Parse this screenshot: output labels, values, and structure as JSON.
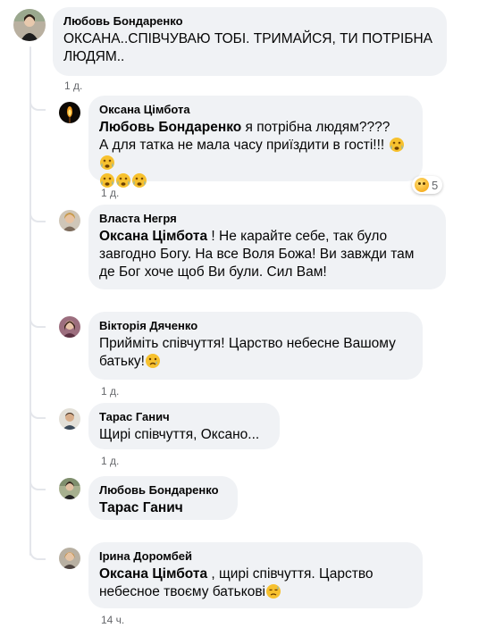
{
  "comments": [
    {
      "author": "Любовь Бондаренко",
      "text": "ОКСАНА..СПІВЧУВАЮ ТОБІ. ТРИМАЙСЯ, ТИ ПОТРІБНА ЛЮДЯМ..",
      "line1": "ОКСАНА..СПІВЧУВАЮ ТОБІ. ТРИМАЙСЯ, ТИ ПОТРІБНА",
      "line2": "ЛЮДЯМ..",
      "time": "1 д."
    }
  ],
  "replies": [
    {
      "author": "Оксана Цімбота",
      "mention": "Любовь Бондаренко",
      "line1": " я потрібна людям????",
      "line2": "А для татка не мала часу приїздити в гості!!!",
      "time": "1 д.",
      "reaction_count": "5",
      "reaction_icon": "sad-face-icon"
    },
    {
      "author": "Власта Негря",
      "mention": "Оксана Цімбота",
      "line1": " ! Не карайте себе, так було",
      "line2": "завгодно Богу. На все Воля Божа! Ви завжди там",
      "line3": "де Бог хоче щоб Ви були. Сил Вам!",
      "time": ""
    },
    {
      "author": "Вікторія Дяченко",
      "line1": "Прийміть співчуття! Царство небесне Вашому",
      "line2": "батьку!",
      "time": "1 д."
    },
    {
      "author": "Тарас Ганич",
      "line1": "Щирі співчуття, Оксано...",
      "time": "1 д."
    },
    {
      "author": "Любовь Бондаренко",
      "mention": "Тарас Ганич",
      "time": ""
    },
    {
      "author": "Ірина Доромбей",
      "mention": "Оксана Цімбота",
      "line1": " , щирі співчуття. Царство",
      "line2": "небесное твоєму батькові",
      "time": "14 ч."
    }
  ],
  "colors": {
    "bubble": "#f0f2f5",
    "text": "#050505",
    "meta": "#65676b",
    "thread_line": "#e4e6eb"
  }
}
